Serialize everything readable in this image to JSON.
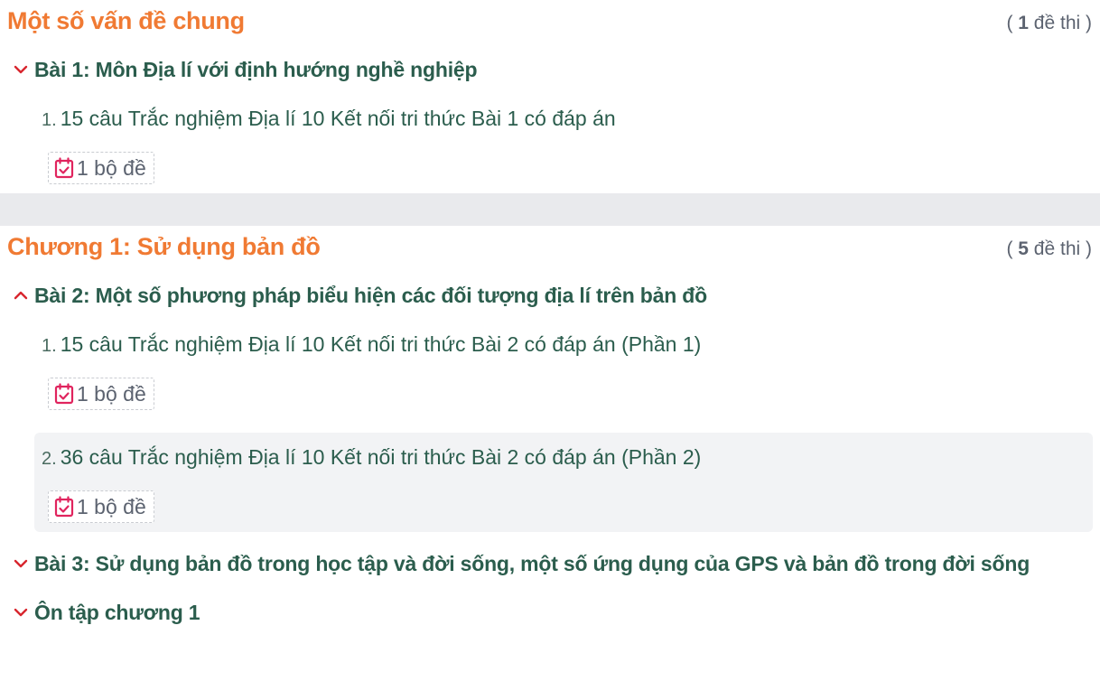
{
  "sections": [
    {
      "title": "Một số vấn đề chung",
      "count_open": "( ",
      "count_num": "1",
      "count_close": " đề thi )",
      "lessons": [
        {
          "title": "Bài 1: Môn Địa lí với định hướng nghề nghiệp",
          "expanded": false,
          "items": [
            {
              "num": "1.",
              "title": "15 câu Trắc nghiệm Địa lí 10 Kết nối tri thức Bài 1 có đáp án",
              "badge": "1 bộ đề"
            }
          ]
        }
      ]
    },
    {
      "title": "Chương 1: Sử dụng bản đồ",
      "count_open": "( ",
      "count_num": "5",
      "count_close": " đề thi )",
      "lessons": [
        {
          "title": "Bài 2: Một số phương pháp biểu hiện các đối tượng địa lí trên bản đồ",
          "expanded": true,
          "items": [
            {
              "num": "1.",
              "title": "15 câu Trắc nghiệm Địa lí 10 Kết nối tri thức Bài 2 có đáp án (Phần 1)",
              "badge": "1 bộ đề"
            },
            {
              "num": "2.",
              "title": "36 câu Trắc nghiệm Địa lí 10 Kết nối tri thức Bài 2 có đáp án (Phần 2)",
              "badge": "1 bộ đề"
            }
          ]
        },
        {
          "title": "Bài 3: Sử dụng bản đồ trong học tập và đời sống, một số ứng dụng của GPS và bản đồ trong đời sống",
          "expanded": false
        },
        {
          "title": "Ôn tập chương 1",
          "expanded": false
        }
      ]
    }
  ],
  "icons": {
    "chevron_down": "chevron-down-icon",
    "chevron_up": "chevron-up-icon",
    "calendar_check": "calendar-check-icon"
  },
  "colors": {
    "section_title": "#f07a33",
    "lesson_title": "#2b5d4d",
    "chevron": "#d8262e",
    "calendar_icon": "#e0245e",
    "divider": "#e9eaed",
    "hover_bg": "#f2f3f5"
  }
}
